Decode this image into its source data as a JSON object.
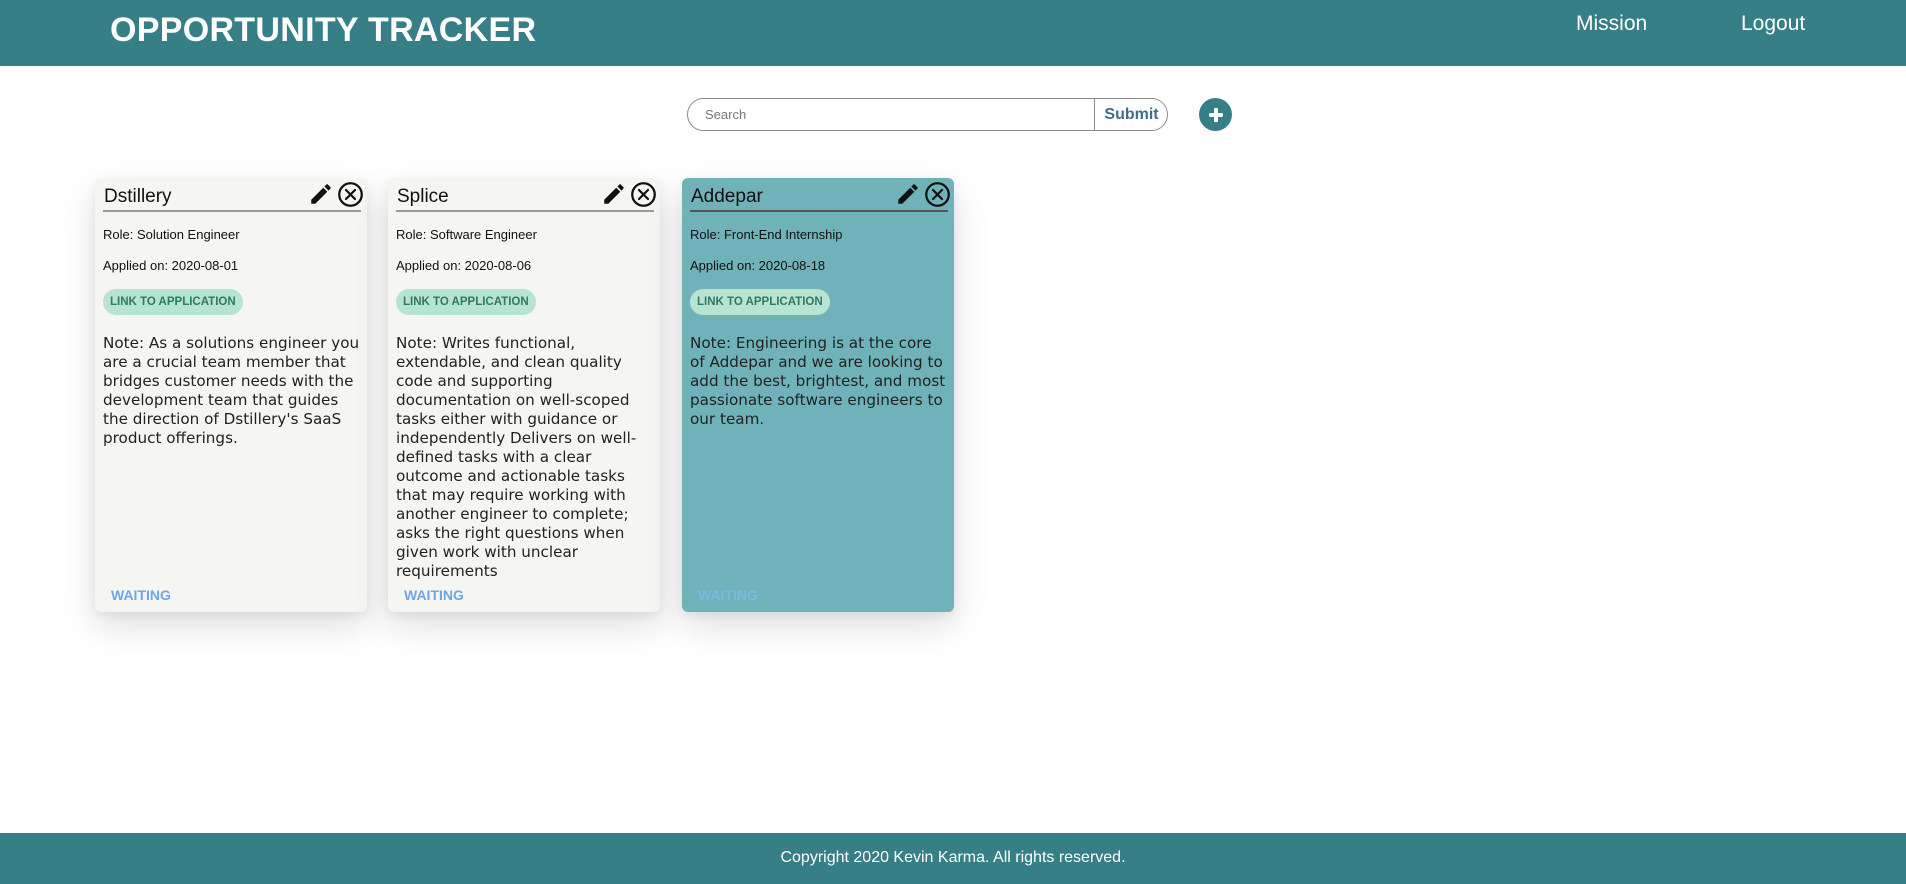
{
  "header": {
    "title": "OPPORTUNITY TRACKER",
    "nav": {
      "mission": "Mission",
      "logout": "Logout"
    }
  },
  "search": {
    "placeholder": "Search",
    "value": "",
    "submit_label": "Submit"
  },
  "add_button": {
    "icon": "plus-icon"
  },
  "cards": [
    {
      "company": "Dstillery",
      "role": "Role: Solution Engineer",
      "applied": "Applied on: 2020-08-01",
      "link_label": "LINK TO APPLICATION",
      "note": "Note: As a solutions engineer you are a crucial team member that bridges customer needs with the development team that guides the direction of Dstillery's SaaS product offerings.",
      "status": "WAITING",
      "selected": false
    },
    {
      "company": "Splice",
      "role": "Role: Software Engineer",
      "applied": "Applied on: 2020-08-06",
      "link_label": "LINK TO APPLICATION",
      "note": "Note: Writes functional, extendable, and clean quality code and supporting documentation on well-scoped tasks either with guidance or independently Delivers on well-defined tasks with a clear outcome and actionable tasks that may require working with another engineer to complete; asks the right questions when given work with unclear requirements",
      "status": "WAITING",
      "selected": false
    },
    {
      "company": "Addepar",
      "role": "Role: Front-End Internship",
      "applied": "Applied on: 2020-08-18",
      "link_label": "LINK TO APPLICATION",
      "note": "Note: Engineering is at the core of Addepar and we are looking to add the best, brightest, and most passionate software engineers to our team.",
      "status": "WAITING",
      "selected": true
    }
  ],
  "footer": {
    "copyright": "Copyright 2020 Kevin Karma. All rights reserved."
  },
  "colors": {
    "brand": "#367f87",
    "selected_card": "#70b2b9",
    "card": "#f5f5f2",
    "pill_bg": "#b7e3d1",
    "pill_text": "#2f7a63",
    "status": "#6aa9e3"
  },
  "icons": {
    "edit": "pencil-icon",
    "delete": "circle-x-icon"
  }
}
